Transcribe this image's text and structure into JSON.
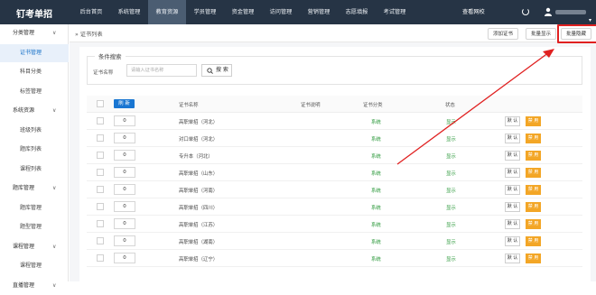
{
  "app": {
    "logo": "钉考单招"
  },
  "nav": [
    "后台首页",
    "系统管理",
    "教育资源",
    "学员管理",
    "资金管理",
    "访问管理",
    "营销管理",
    "志愿填报",
    "考试管理"
  ],
  "nav_active": 2,
  "top_right": {
    "view_site": "查看网校",
    "refresh_label": "C"
  },
  "sidebar": [
    {
      "label": "分类管理",
      "type": "group"
    },
    {
      "label": "证书管理",
      "type": "child",
      "active": true
    },
    {
      "label": "科目分类",
      "type": "child"
    },
    {
      "label": "标签管理",
      "type": "child"
    },
    {
      "label": "系统资源",
      "type": "group"
    },
    {
      "label": "班级列表",
      "type": "child"
    },
    {
      "label": "题库列表",
      "type": "child"
    },
    {
      "label": "课程列表",
      "type": "child"
    },
    {
      "label": "题库管理",
      "type": "group"
    },
    {
      "label": "题库管理",
      "type": "child"
    },
    {
      "label": "题型管理",
      "type": "child"
    },
    {
      "label": "课程管理",
      "type": "group"
    },
    {
      "label": "课程管理",
      "type": "child"
    },
    {
      "label": "直播管理",
      "type": "group"
    }
  ],
  "page": {
    "title": "证书列表",
    "buttons": {
      "add": "添加证书",
      "batch_show": "批量显示",
      "batch_hide": "批量隐藏"
    }
  },
  "search": {
    "legend": "条件搜索",
    "label": "证书名称",
    "placeholder": "请输入证书名称",
    "button": "搜 索"
  },
  "table": {
    "refresh": "刷 新",
    "headers": [
      "证书名称",
      "证书说明",
      "证书分类",
      "状态"
    ],
    "default_btn": "默 认",
    "disable_btn": "禁 用",
    "rows": [
      {
        "sort": "0",
        "name": "高职单招（河北）",
        "category": "系统",
        "status": "显示"
      },
      {
        "sort": "0",
        "name": "对口单招（河北）",
        "category": "系统",
        "status": "显示"
      },
      {
        "sort": "0",
        "name": "专升本（河北）",
        "category": "系统",
        "status": "显示"
      },
      {
        "sort": "0",
        "name": "高职单招（山东）",
        "category": "系统",
        "status": "显示"
      },
      {
        "sort": "0",
        "name": "高职单招（河南）",
        "category": "系统",
        "status": "显示"
      },
      {
        "sort": "0",
        "name": "高职单招（四川）",
        "category": "系统",
        "status": "显示"
      },
      {
        "sort": "0",
        "name": "高职单招（江苏）",
        "category": "系统",
        "status": "显示"
      },
      {
        "sort": "0",
        "name": "高职单招（湖南）",
        "category": "系统",
        "status": "显示"
      },
      {
        "sort": "0",
        "name": "高职单招（辽宁）",
        "category": "系统",
        "status": "显示"
      }
    ]
  },
  "colors": {
    "topbar": "#263445",
    "accent": "#1976d2",
    "highlight": "#e02020",
    "warn": "#f3a626",
    "ok": "#2e9a3d"
  }
}
